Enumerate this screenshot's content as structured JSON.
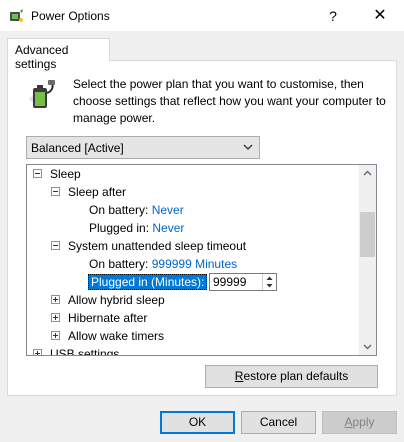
{
  "window": {
    "title": "Power Options",
    "help_glyph": "?",
    "close_glyph": "✕"
  },
  "tabs": [
    {
      "label": "Advanced settings"
    }
  ],
  "description": "Select the power plan that you want to customise, then choose settings that reflect how you want your computer to manage power.",
  "plan_select": {
    "value": "Balanced [Active]"
  },
  "tree": {
    "sleep": "Sleep",
    "sleep_after": "Sleep after",
    "on_battery_label": "On battery:",
    "plugged_in_label": "Plugged in:",
    "sleep_after_battery": "Never",
    "sleep_after_plugged": "Never",
    "unattended": "System unattended sleep timeout",
    "unattended_battery": "999999 Minutes",
    "plugged_minutes_label": "Plugged in (Minutes):",
    "plugged_minutes_value": "99999",
    "hybrid": "Allow hybrid sleep",
    "hibernate": "Hibernate after",
    "wake": "Allow wake timers",
    "usb": "USB settings"
  },
  "buttons": {
    "restore_prefix": "",
    "restore_access": "R",
    "restore_rest": "estore plan defaults",
    "ok": "OK",
    "cancel": "Cancel",
    "apply_access": "A",
    "apply_rest": "pply"
  },
  "colors": {
    "link": "#0066cc",
    "selection": "#0078d7",
    "dialog_bg": "#f0f0f0"
  }
}
